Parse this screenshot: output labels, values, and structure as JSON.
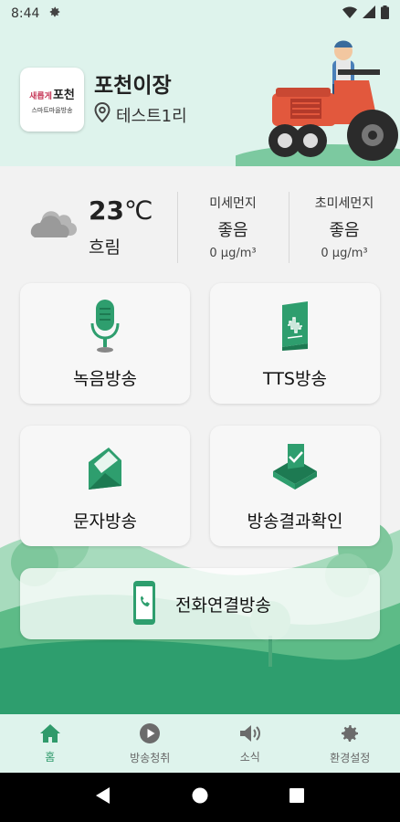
{
  "status_bar": {
    "time": "8:44"
  },
  "header": {
    "logo_accent": "새롭게",
    "logo_main": "포천",
    "logo_sub": "스마트마을방송",
    "org_name": "포천이장",
    "village": "테스트1리"
  },
  "weather": {
    "temperature": "23",
    "temp_unit": "℃",
    "condition": "흐림",
    "fine_dust": {
      "label": "미세먼지",
      "status": "좋음",
      "value": "0 μg/m³"
    },
    "ultra_fine_dust": {
      "label": "초미세먼지",
      "status": "좋음",
      "value": "0 μg/m³"
    }
  },
  "menu": {
    "record": "녹음방송",
    "tts": "TTS방송",
    "sms": "문자방송",
    "result": "방송결과확인",
    "call": "전화연결방송"
  },
  "bottom_nav": [
    {
      "label": "홈",
      "icon": "home-icon",
      "active": true
    },
    {
      "label": "방송청취",
      "icon": "play-icon",
      "active": false
    },
    {
      "label": "소식",
      "icon": "speaker-icon",
      "active": false
    },
    {
      "label": "환경설정",
      "icon": "gear-icon",
      "active": false
    }
  ],
  "colors": {
    "accent": "#2f9a6b",
    "header_bg": "#def3ec",
    "icon_green": "#2e9e6e"
  }
}
